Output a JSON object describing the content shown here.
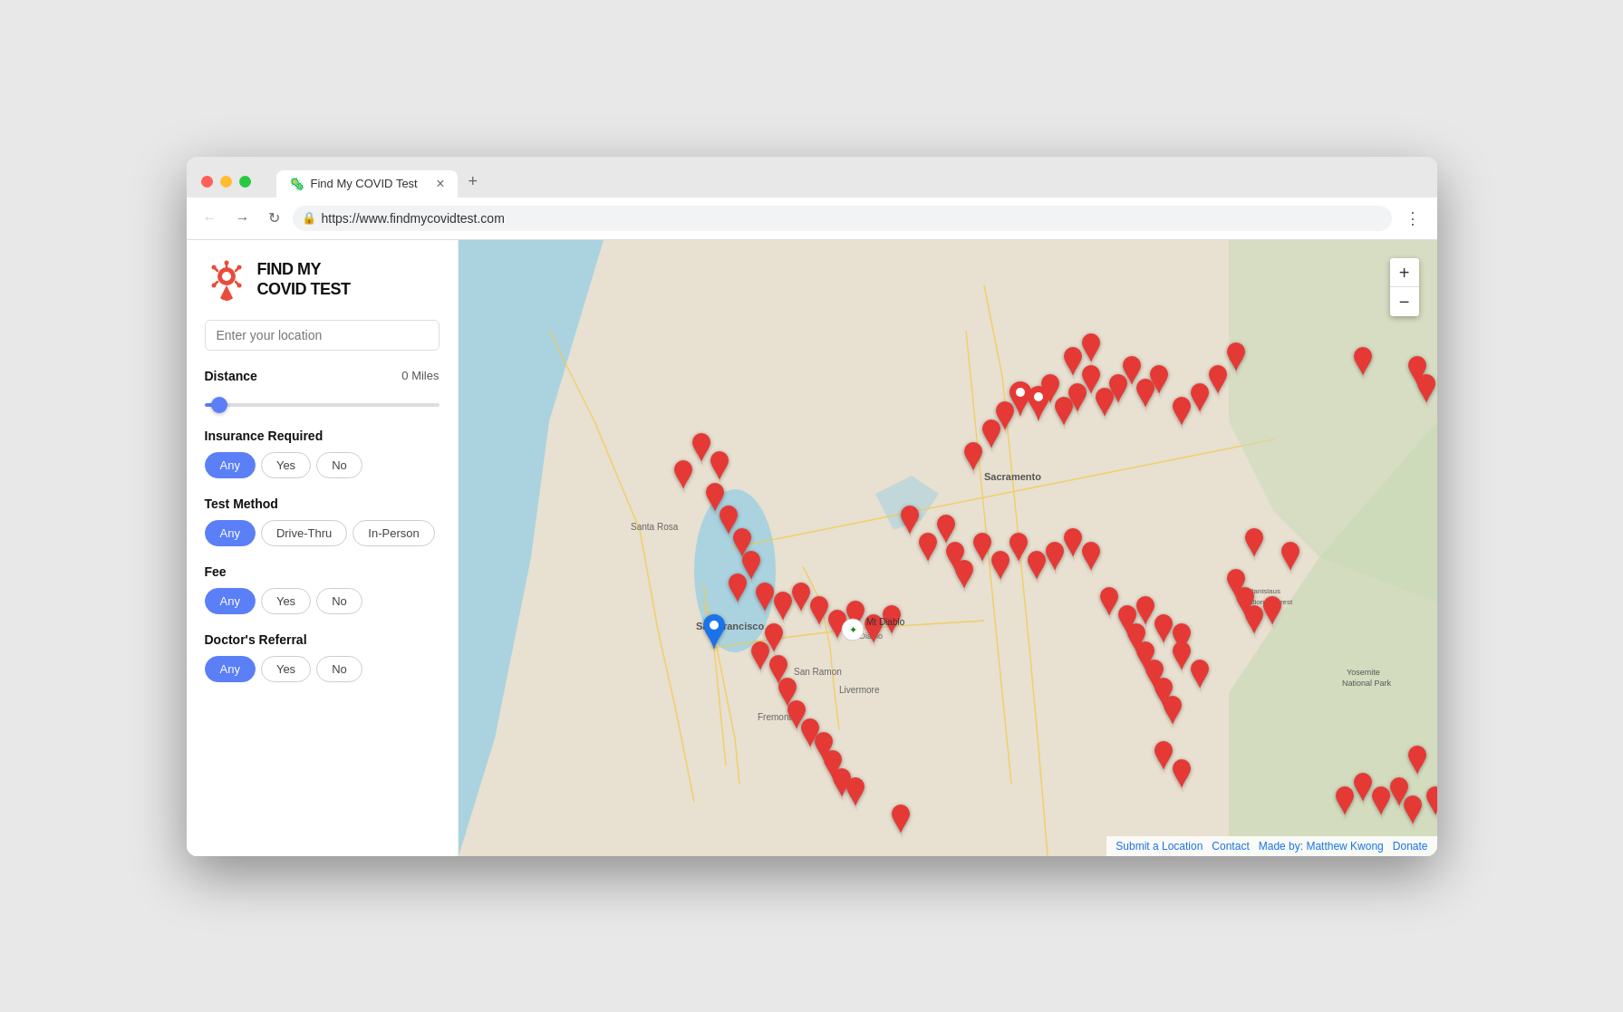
{
  "browser": {
    "tab_title": "Find My COVID Test",
    "url": "https://www.findmycovidtest.com",
    "close_label": "×",
    "new_tab_label": "+",
    "menu_label": "⋮"
  },
  "sidebar": {
    "logo_text": "FIND MY\nCOVID TEST",
    "location_placeholder": "Enter your location",
    "distance_label": "Distance",
    "distance_value": "0 Miles",
    "insurance_label": "Insurance Required",
    "test_method_label": "Test Method",
    "fee_label": "Fee",
    "doctors_referral_label": "Doctor's Referral",
    "btn_any": "Any",
    "btn_yes": "Yes",
    "btn_no": "No",
    "btn_drive_thru": "Drive-Thru",
    "btn_in_person": "In-Person"
  },
  "map": {
    "zoom_in": "+",
    "zoom_out": "−",
    "submit_link": "Submit a Location",
    "contact_link": "Contact",
    "made_by_link": "Made by: Matthew Kwong",
    "donate_link": "Donate"
  }
}
